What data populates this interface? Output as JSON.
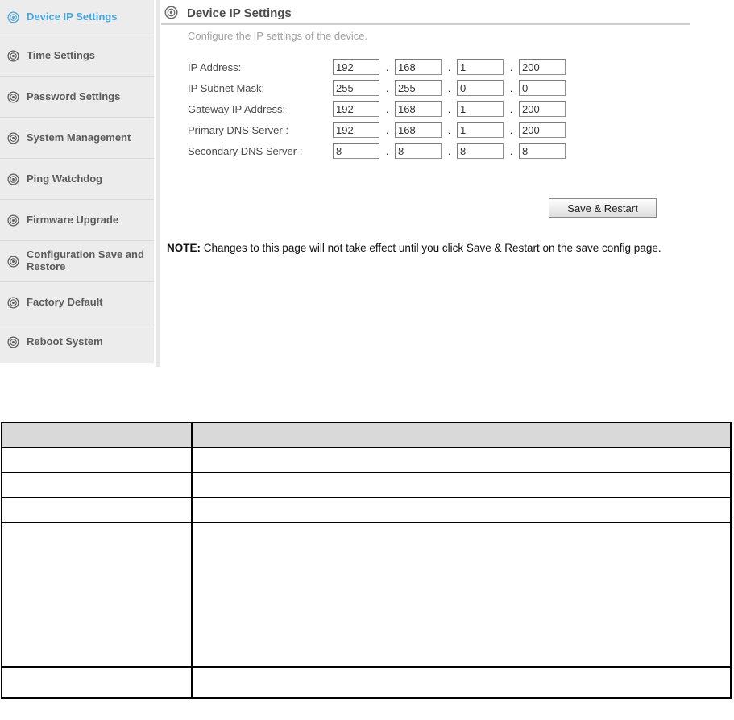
{
  "sidebar": {
    "items": [
      {
        "label": "Device IP Settings",
        "active": true
      },
      {
        "label": "Time Settings",
        "active": false
      },
      {
        "label": "Password Settings",
        "active": false
      },
      {
        "label": "System Management",
        "active": false
      },
      {
        "label": "Ping Watchdog",
        "active": false
      },
      {
        "label": "Firmware Upgrade",
        "active": false
      },
      {
        "label": "Configuration Save and Restore",
        "active": false
      },
      {
        "label": "Factory Default",
        "active": false
      },
      {
        "label": "Reboot System",
        "active": false
      }
    ]
  },
  "main": {
    "title": "Device IP Settings",
    "subtitle": "Configure the IP settings of the device.",
    "fields": [
      {
        "label": "IP Address:",
        "octets": [
          "192",
          "168",
          "1",
          "200"
        ]
      },
      {
        "label": "IP Subnet Mask:",
        "octets": [
          "255",
          "255",
          "0",
          "0"
        ]
      },
      {
        "label": "Gateway IP Address:",
        "octets": [
          "192",
          "168",
          "1",
          "200"
        ]
      },
      {
        "label": "Primary DNS Server :",
        "octets": [
          "192",
          "168",
          "1",
          "200"
        ]
      },
      {
        "label": "Secondary DNS Server :",
        "octets": [
          "8",
          "8",
          "8",
          "8"
        ]
      }
    ],
    "octet_separator": ".",
    "save_button_label": "Save & Restart",
    "note_label": "NOTE:",
    "note_text": " Changes to this page will not take effect until you click Save & Restart on the save config page."
  },
  "doc_table": {
    "header": [
      "",
      ""
    ],
    "rows": [
      [
        "",
        ""
      ],
      [
        "",
        ""
      ],
      [
        "",
        ""
      ],
      [
        "",
        ""
      ],
      [
        "",
        ""
      ]
    ]
  },
  "colors": {
    "accent_blue": "#4aa5db",
    "sidebar_bg": "#ececec",
    "table_header_bg": "#d9d9d9"
  }
}
